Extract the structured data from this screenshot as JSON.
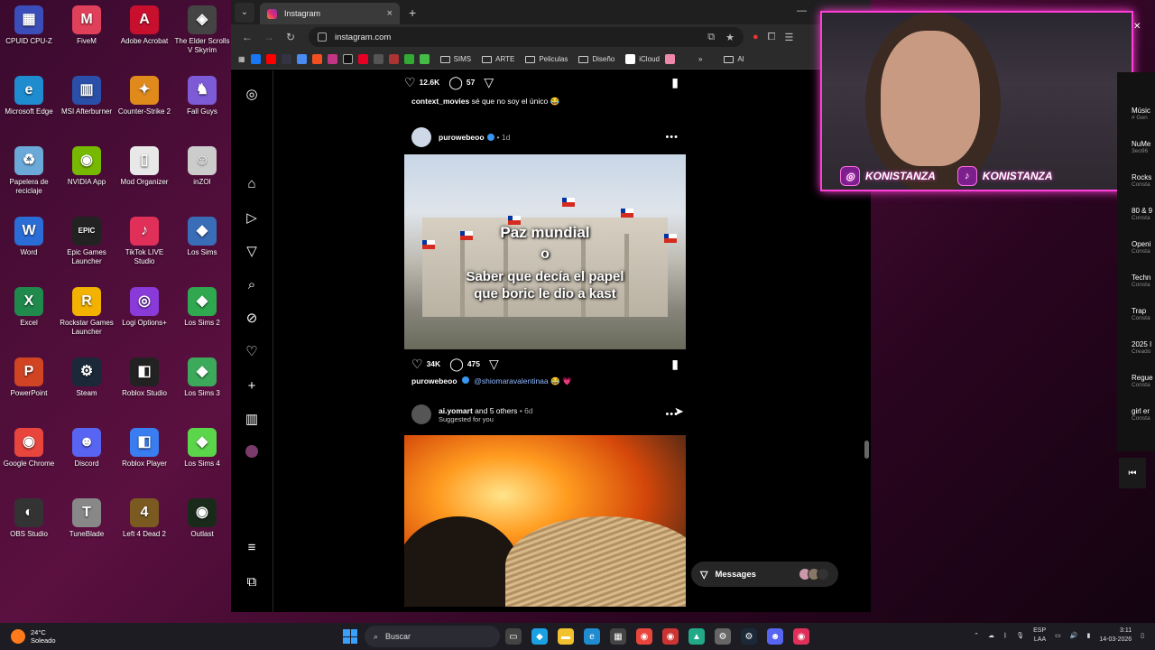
{
  "desktop": {
    "icons": [
      {
        "label": "CPUID CPU-Z",
        "color": "#3b4db8",
        "glyph": "▦"
      },
      {
        "label": "FiveM",
        "color": "#e0405a",
        "glyph": "M"
      },
      {
        "label": "Adobe Acrobat",
        "color": "#c8102e",
        "glyph": "A"
      },
      {
        "label": "The Elder Scrolls V Skyrim",
        "color": "#444",
        "glyph": "◈"
      },
      {
        "label": "Microsoft Edge",
        "color": "#1e8ccf",
        "glyph": "e"
      },
      {
        "label": "MSI Afterburner",
        "color": "#2a4fa8",
        "glyph": "▥"
      },
      {
        "label": "Counter-Strike 2",
        "color": "#e08a1c",
        "glyph": "✦"
      },
      {
        "label": "Fall Guys",
        "color": "#7d5bd6",
        "glyph": "♞"
      },
      {
        "label": "Papelera de reciclaje",
        "color": "#6aa9d8",
        "glyph": "♻"
      },
      {
        "label": "NVIDIA App",
        "color": "#76b900",
        "glyph": "◉"
      },
      {
        "label": "Mod Organizer",
        "color": "#e8e8e8",
        "glyph": "▯"
      },
      {
        "label": "inZOI",
        "color": "#ccc",
        "glyph": "☺"
      },
      {
        "label": "Word",
        "color": "#2b6dd6",
        "glyph": "W"
      },
      {
        "label": "Epic Games Launcher",
        "color": "#222",
        "glyph": "EPIC"
      },
      {
        "label": "TikTok LIVE Studio",
        "color": "#e0305a",
        "glyph": "♪"
      },
      {
        "label": "Los Sims",
        "color": "#3a6db8",
        "glyph": "◆"
      },
      {
        "label": "Excel",
        "color": "#1f8a4c",
        "glyph": "X"
      },
      {
        "label": "Rockstar Games Launcher",
        "color": "#f3b200",
        "glyph": "R"
      },
      {
        "label": "Logi Options+",
        "color": "#8a3ad8",
        "glyph": "◎"
      },
      {
        "label": "Los Sims 2",
        "color": "#2fa84f",
        "glyph": "◆"
      },
      {
        "label": "PowerPoint",
        "color": "#d04423",
        "glyph": "P"
      },
      {
        "label": "Steam",
        "color": "#1b2838",
        "glyph": "⚙"
      },
      {
        "label": "Roblox Studio",
        "color": "#222",
        "glyph": "◧"
      },
      {
        "label": "Los Sims 3",
        "color": "#3caa5a",
        "glyph": "◆"
      },
      {
        "label": "Google Chrome",
        "color": "#e8453c",
        "glyph": "◉"
      },
      {
        "label": "Discord",
        "color": "#5865f2",
        "glyph": "☻"
      },
      {
        "label": "Roblox Player",
        "color": "#3a7df0",
        "glyph": "◧"
      },
      {
        "label": "Los Sims 4",
        "color": "#5bd64a",
        "glyph": "◆"
      },
      {
        "label": "OBS Studio",
        "color": "#333",
        "glyph": "◐"
      },
      {
        "label": "TuneBlade",
        "color": "#888",
        "glyph": "T"
      },
      {
        "label": "Left 4 Dead 2",
        "color": "#7a5a20",
        "glyph": "4"
      },
      {
        "label": "Outlast",
        "color": "#1a2a1a",
        "glyph": "◉"
      }
    ]
  },
  "browser": {
    "tab_title": "Instagram",
    "url": "instagram.com",
    "bookmarks": {
      "folders": [
        "SIMS",
        "ARTE",
        "Peliculas",
        "Diseño",
        "iCloud"
      ],
      "overflow": "»",
      "trailing": "Al"
    }
  },
  "instagram": {
    "sidebar_icons": [
      "instagram-logo-icon",
      "home-icon",
      "reels-icon",
      "share-icon",
      "search-icon",
      "explore-icon",
      "heart-icon",
      "create-icon",
      "dashboard-icon",
      "profile-icon",
      "menu-icon",
      "more-icon"
    ],
    "prev_post": {
      "likes": "12.6K",
      "comments": "57",
      "caption_user": "context_movies",
      "caption_text": "sé que no soy el único 😂"
    },
    "post1": {
      "username": "purowebeoo",
      "time": "• 1d",
      "meme_line1": "Paz mundial",
      "meme_line2": "o",
      "meme_line3": "Saber que decía el papel",
      "meme_line4": "que boric le dio a kast",
      "likes": "34K",
      "comments": "475",
      "caption_user": "purowebeoo",
      "caption_mention": "@shiomaravalentinaa",
      "caption_emoji": "😂 💗"
    },
    "post2": {
      "username": "ai.yomart",
      "others": "and 5 others",
      "time": "• 6d",
      "subtitle": "Suggested for you"
    },
    "messages_label": "Messages"
  },
  "stream": {
    "instagram_handle": "KONISTANZA",
    "tiktok_handle": "KONISTANZA",
    "playlist": [
      {
        "title": "Músic",
        "sub": "# Gen"
      },
      {
        "title": "NuMe",
        "sub": "3eo96"
      },
      {
        "title": "Rocks",
        "sub": "Consta"
      },
      {
        "title": "80 & 9",
        "sub": "Consta"
      },
      {
        "title": "Openi",
        "sub": "Consta"
      },
      {
        "title": "Techn",
        "sub": "Consta"
      },
      {
        "title": "Trap",
        "sub": "Consta"
      },
      {
        "title": "2025 I",
        "sub": "Creado"
      },
      {
        "title": "Regue",
        "sub": "Consta"
      },
      {
        "title": "girl er",
        "sub": "Consta"
      }
    ]
  },
  "taskbar": {
    "weather_temp": "24°C",
    "weather_desc": "Soleado",
    "search_placeholder": "Buscar",
    "lang": "ESP",
    "lang_sub": "LAA",
    "time": "3:11",
    "date": "14-03-2026"
  }
}
